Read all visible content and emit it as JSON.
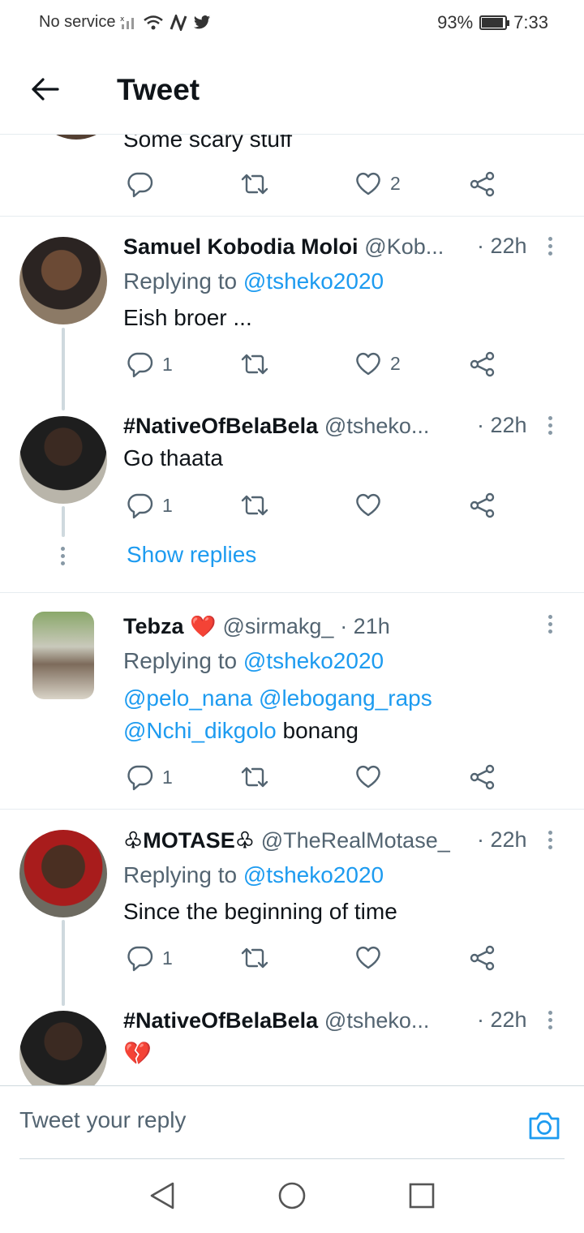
{
  "status": {
    "carrier": "No service",
    "battery": "93%",
    "battery_level": 0.93,
    "time": "7:33"
  },
  "header": {
    "title": "Tweet"
  },
  "partial_tweet": {
    "text": "Some scary stuff",
    "likes": "2"
  },
  "tweets": [
    {
      "name": "Samuel Kobodia Moloi",
      "handle": "@Kob...",
      "time": "· 22h",
      "replying_label": "Replying to",
      "replying_to": "@tsheko2020",
      "text": "Eish broer ...",
      "replies": "1",
      "likes": "2"
    },
    {
      "name": "#NativeOfBelaBela",
      "handle": "@tsheko...",
      "time": "· 22h",
      "text": "Go thaata",
      "replies": "1"
    },
    {
      "name": "Tebza",
      "heart": "❤️",
      "handle": "@sirmakg_",
      "time": "· 21h",
      "replying_label": "Replying to",
      "replying_to": "@tsheko2020",
      "mention1": "@pelo_nana",
      "mention2": "@lebogang_raps",
      "mention3": "@Nchi_dikgolo",
      "text": "bonang",
      "replies": "1"
    },
    {
      "name": "♧MOTASE♧",
      "handle": "@TheRealMotase_",
      "time": "· 22h",
      "replying_label": "Replying to",
      "replying_to": "@tsheko2020",
      "text": "Since the beginning of time",
      "replies": "1"
    },
    {
      "name": "#NativeOfBelaBela",
      "handle": "@tsheko...",
      "time": "· 22h",
      "text": "💔"
    }
  ],
  "show_replies": "Show replies",
  "reply_bar": {
    "placeholder": "Tweet your reply"
  },
  "colors": {
    "link": "#1d9bf0",
    "secondary": "#536471",
    "divider": "#e6ecf0"
  }
}
